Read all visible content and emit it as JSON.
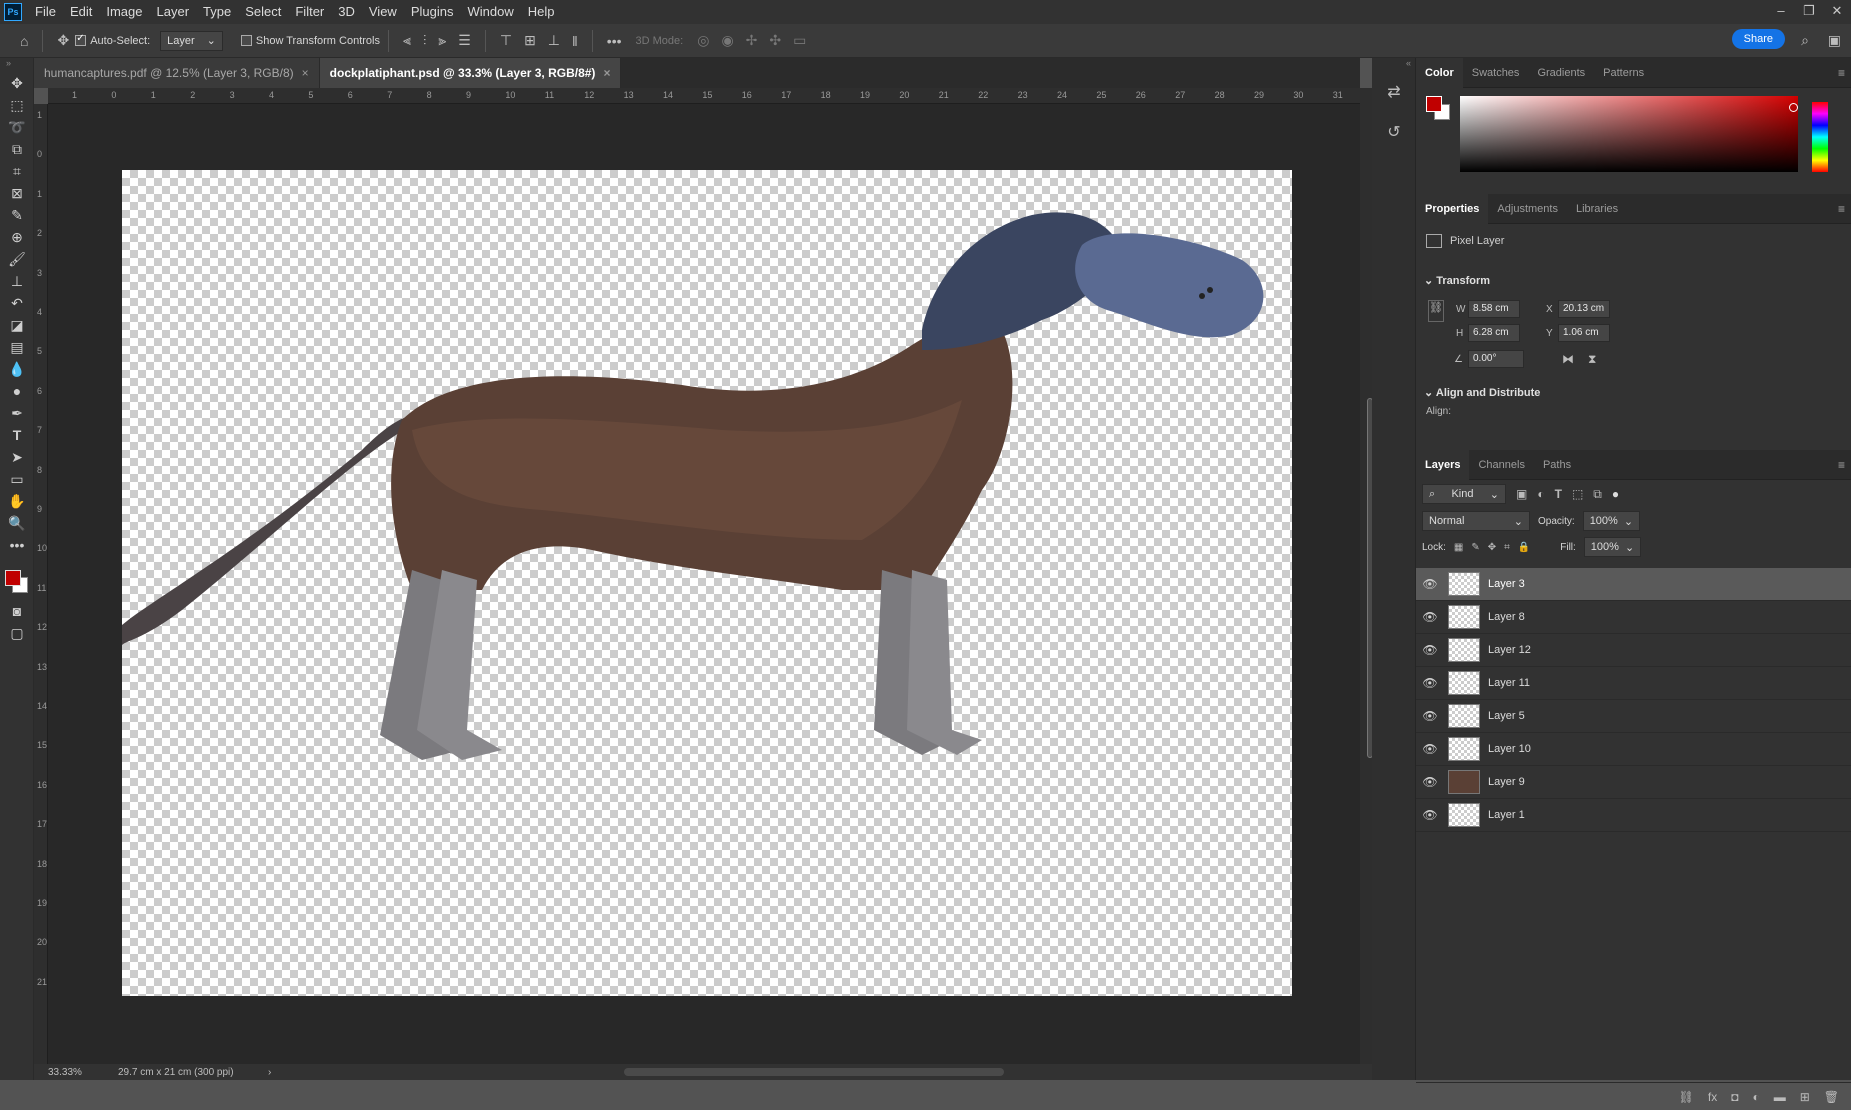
{
  "app": {
    "logo": "Ps"
  },
  "menu": [
    "File",
    "Edit",
    "Image",
    "Layer",
    "Type",
    "Select",
    "Filter",
    "3D",
    "View",
    "Plugins",
    "Window",
    "Help"
  ],
  "window_controls": [
    "–",
    "❐",
    "✕"
  ],
  "options": {
    "auto_select_label": "Auto-Select:",
    "auto_select_value": "Layer",
    "show_transform_label": "Show Transform Controls",
    "more": "•••",
    "three_d_mode": "3D Mode:",
    "share": "Share"
  },
  "tabs": [
    {
      "label": "humancaptures.pdf @ 12.5% (Layer 3, RGB/8)",
      "close": "×"
    },
    {
      "label": "dockplatiphant.psd @ 33.3% (Layer 3, RGB/8#)",
      "close": "×"
    }
  ],
  "ruler_h": [
    "1",
    "0",
    "1",
    "2",
    "3",
    "4",
    "5",
    "6",
    "7",
    "8",
    "9",
    "10",
    "11",
    "12",
    "13",
    "14",
    "15",
    "16",
    "17",
    "18",
    "19",
    "20",
    "21",
    "22",
    "23",
    "24",
    "25",
    "26",
    "27",
    "28",
    "29",
    "30",
    "31"
  ],
  "ruler_v": [
    "1",
    "0",
    "1",
    "2",
    "3",
    "4",
    "5",
    "6",
    "7",
    "8",
    "9",
    "10",
    "11",
    "12",
    "13",
    "14",
    "15",
    "16",
    "17",
    "18",
    "19",
    "20",
    "21"
  ],
  "status": {
    "zoom": "33.33%",
    "doc_size": "29.7 cm x 21 cm (300 ppi)",
    "arrow": "›"
  },
  "color_panel": {
    "tabs": [
      "Color",
      "Swatches",
      "Gradients",
      "Patterns"
    ],
    "foreground": "#c00000",
    "background": "#ffffff"
  },
  "properties": {
    "tabs": [
      "Properties",
      "Adjustments",
      "Libraries"
    ],
    "type": "Pixel Layer",
    "transform_title": "Transform",
    "w_label": "W",
    "w_value": "8.58 cm",
    "h_label": "H",
    "h_value": "6.28 cm",
    "x_label": "X",
    "x_value": "20.13 cm",
    "y_label": "Y",
    "y_value": "1.06 cm",
    "angle_value": "0.00°",
    "align_title": "Align and Distribute",
    "align_label": "Align:"
  },
  "layers": {
    "tabs": [
      "Layers",
      "Channels",
      "Paths"
    ],
    "filter_kind": "Kind",
    "blend_mode": "Normal",
    "opacity_label": "Opacity:",
    "opacity_value": "100%",
    "lock_label": "Lock:",
    "fill_label": "Fill:",
    "fill_value": "100%",
    "items": [
      {
        "name": "Layer 3",
        "selected": true
      },
      {
        "name": "Layer 8"
      },
      {
        "name": "Layer 12"
      },
      {
        "name": "Layer 11"
      },
      {
        "name": "Layer 5"
      },
      {
        "name": "Layer 10"
      },
      {
        "name": "Layer 9"
      },
      {
        "name": "Layer 1"
      }
    ]
  }
}
